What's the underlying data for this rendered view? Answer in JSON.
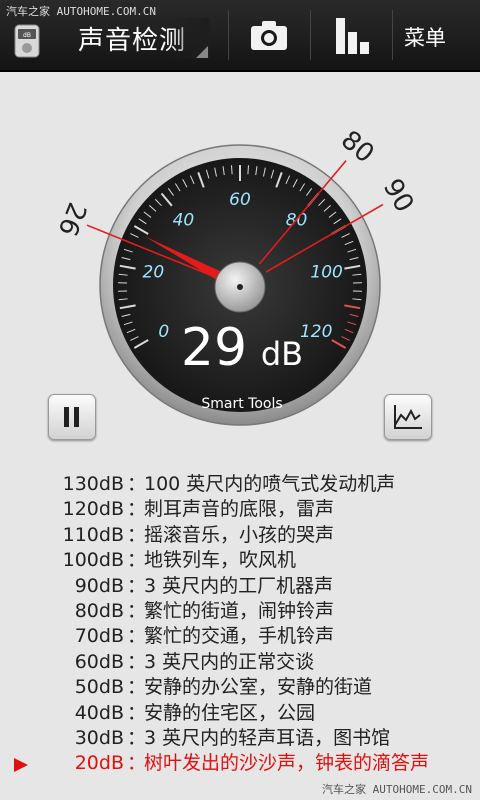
{
  "watermark": {
    "top": "汽车之家 AUTOHOME.COM.CN",
    "bottom": "汽车之家 AUTOHOME.COM.CN"
  },
  "header": {
    "title": "声音检测",
    "menu_label": "菜单",
    "icons": [
      "sound-meter-app-icon",
      "dropdown-triangle-icon",
      "camera-icon",
      "bar-chart-icon"
    ]
  },
  "gauge": {
    "reading_value": "29",
    "reading_unit": "dB",
    "brand": "Smart Tools",
    "current_db": 29,
    "min_marker": 26,
    "max_marker": 90,
    "extra_marker": 80,
    "scale_min": 0,
    "scale_max": 120,
    "tick_labels": [
      "0",
      "20",
      "40",
      "60",
      "80",
      "100",
      "120"
    ],
    "marker_labels": {
      "min": "26",
      "extra": "80",
      "max": "90"
    },
    "colors": {
      "needle": "#e41b1b",
      "scale_text": "#9fe3ff",
      "dial": "#1e1e1e"
    }
  },
  "controls": {
    "pause_icon": "pause-icon",
    "graph_icon": "line-graph-icon"
  },
  "reference": {
    "current_index": 11,
    "rows": [
      {
        "db": "130dB",
        "desc": "100 英尺内的喷气式发动机声"
      },
      {
        "db": "120dB",
        "desc": "刺耳声音的底限，雷声"
      },
      {
        "db": "110dB",
        "desc": "摇滚音乐，小孩的哭声"
      },
      {
        "db": "100dB",
        "desc": "地铁列车，吹风机"
      },
      {
        "db": "90dB",
        "desc": "3 英尺内的工厂机器声"
      },
      {
        "db": "80dB",
        "desc": "繁忙的街道，闹钟铃声"
      },
      {
        "db": "70dB",
        "desc": "繁忙的交通，手机铃声"
      },
      {
        "db": "60dB",
        "desc": "3 英尺内的正常交谈"
      },
      {
        "db": "50dB",
        "desc": "安静的办公室，安静的街道"
      },
      {
        "db": "40dB",
        "desc": "安静的住宅区，公园"
      },
      {
        "db": "30dB",
        "desc": "3 英尺内的轻声耳语，图书馆"
      },
      {
        "db": "20dB",
        "desc": "树叶发出的沙沙声，钟表的滴答声"
      }
    ]
  }
}
